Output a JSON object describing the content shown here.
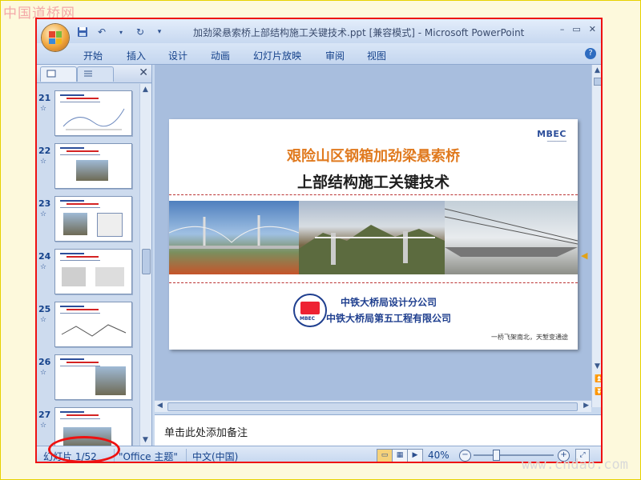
{
  "watermark": {
    "text": "中国道桥网",
    "url": "www.cndao.com"
  },
  "window": {
    "title": "加劲梁悬索桥上部结构施工关键技术.ppt [兼容模式] - Microsoft PowerPoint",
    "controls": [
      "–",
      "▭",
      "✕"
    ]
  },
  "quick_access": {
    "items": [
      "save-icon",
      "undo-icon",
      "redo-icon",
      "customize-icon"
    ]
  },
  "ribbon": {
    "tabs": [
      "开始",
      "插入",
      "设计",
      "动画",
      "幻灯片放映",
      "审阅",
      "视图"
    ],
    "help": "?"
  },
  "slides_pane": {
    "thumbnails": [
      {
        "number": "21",
        "star": "☆"
      },
      {
        "number": "22",
        "star": "☆"
      },
      {
        "number": "23",
        "star": "☆"
      },
      {
        "number": "24",
        "star": "☆"
      },
      {
        "number": "25",
        "star": "☆"
      },
      {
        "number": "26",
        "star": "☆"
      },
      {
        "number": "27",
        "star": "☆"
      }
    ]
  },
  "slide": {
    "brand": "MBEC",
    "title_line1": "艰险山区钢箱加劲梁悬索桥",
    "title_line2": "上部结构施工关键技术",
    "company1": "中铁大桥局设计分公司",
    "company2": "中铁大桥局第五工程有限公司",
    "motto": "一桥飞架南北，天堑变通途",
    "logo_text": "MBEC"
  },
  "notes": {
    "placeholder": "单击此处添加备注"
  },
  "status_bar": {
    "slide_counter": "幻灯片 1/52",
    "theme": "\"Office 主题\"",
    "language": "中文(中国)",
    "zoom": "40%"
  },
  "colors": {
    "title_orange": "#e07a1f",
    "company_blue": "#1f3f8f",
    "highlight_red": "#ee1111"
  }
}
